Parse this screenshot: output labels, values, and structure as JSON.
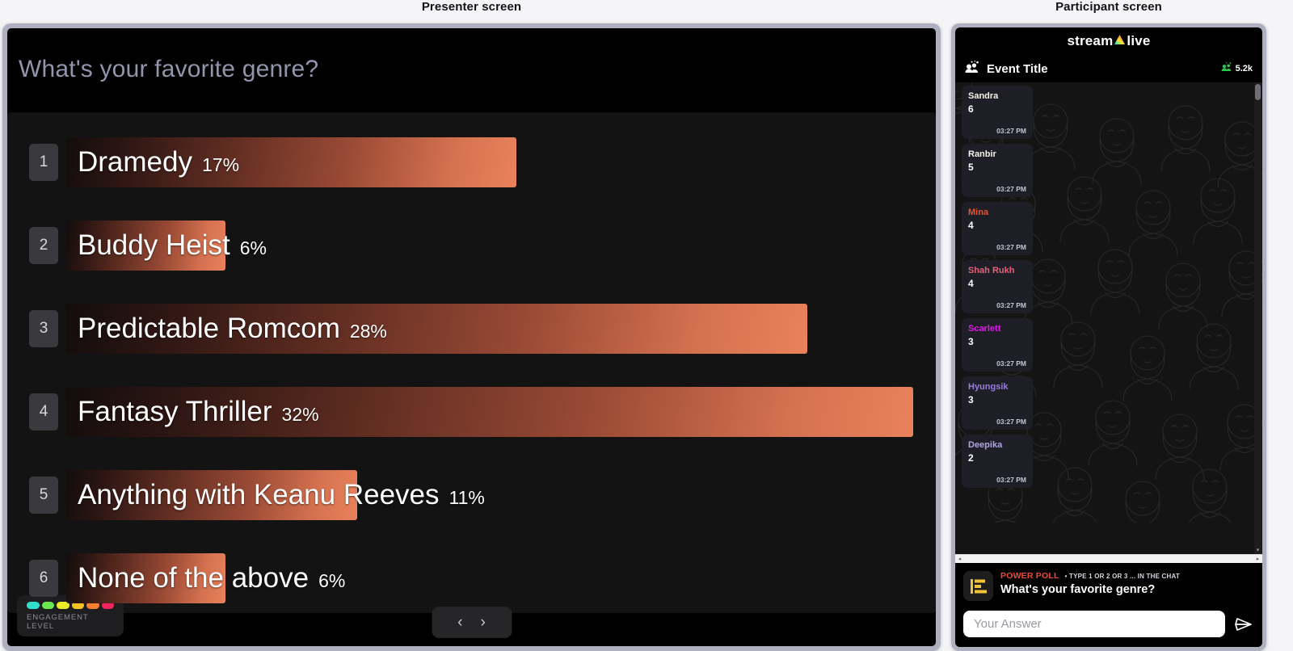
{
  "captions": {
    "presenter": "Presenter screen",
    "participant": "Participant screen"
  },
  "presenter": {
    "poll_title": "What's your favorite genre?",
    "engagement": {
      "label": "ENGAGEMENT LEVEL",
      "colors": [
        "#2fe0cd",
        "#6ae84f",
        "#e8ea2a",
        "#f7c324",
        "#f77f30",
        "#f4245e"
      ]
    },
    "nav": {
      "prev": "‹",
      "next": "›"
    }
  },
  "chart_data": {
    "type": "bar",
    "title": "What's your favorite genre?",
    "xlabel": "",
    "ylabel": "",
    "categories": [
      "Dramedy",
      "Buddy Heist",
      "Predictable Romcom",
      "Fantasy Thriller",
      "Anything with Keanu Reeves",
      "None of the above"
    ],
    "values": [
      17,
      6,
      28,
      32,
      11,
      6
    ],
    "value_labels": [
      "17%",
      "6%",
      "28%",
      "32%",
      "11%",
      "6%"
    ],
    "ranks": [
      "1",
      "2",
      "3",
      "4",
      "5",
      "6"
    ],
    "units": "percent",
    "xlim": [
      0,
      32
    ],
    "grid": false,
    "legend": "none",
    "orientation": "horizontal"
  },
  "participant": {
    "brand": {
      "part1": "stream",
      "part2": "live",
      "mark": "triangle-a"
    },
    "event_title": "Event Title",
    "viewer_count": "5.2k",
    "cards": [
      {
        "name": "Sandra",
        "value": "6",
        "time": "03:27 PM",
        "color": "#f7f1e8"
      },
      {
        "name": "Ranbir",
        "value": "5",
        "time": "03:27 PM",
        "color": "#f4f3ef"
      },
      {
        "name": "Mina",
        "value": "4",
        "time": "03:27 PM",
        "color": "#f0502a"
      },
      {
        "name": "Shah Rukh",
        "value": "4",
        "time": "03:27 PM",
        "color": "#e8607b"
      },
      {
        "name": "Scarlett",
        "value": "3",
        "time": "03:27 PM",
        "color": "#e117e9"
      },
      {
        "name": "Hyungsik",
        "value": "3",
        "time": "03:27 PM",
        "color": "#9a7ce0"
      },
      {
        "name": "Deepika",
        "value": "2",
        "time": "03:27 PM",
        "color": "#b0a4e6"
      }
    ],
    "poll": {
      "tag": "POWER POLL",
      "hint": "• TYPE 1 OR 2 OR 3 ... IN THE CHAT",
      "question": "What's your favorite genre?"
    },
    "answer": {
      "placeholder": "Your Answer",
      "value": ""
    },
    "scroll": {
      "up": "▴",
      "down": "▾",
      "left": "◂",
      "right": "▸"
    }
  }
}
